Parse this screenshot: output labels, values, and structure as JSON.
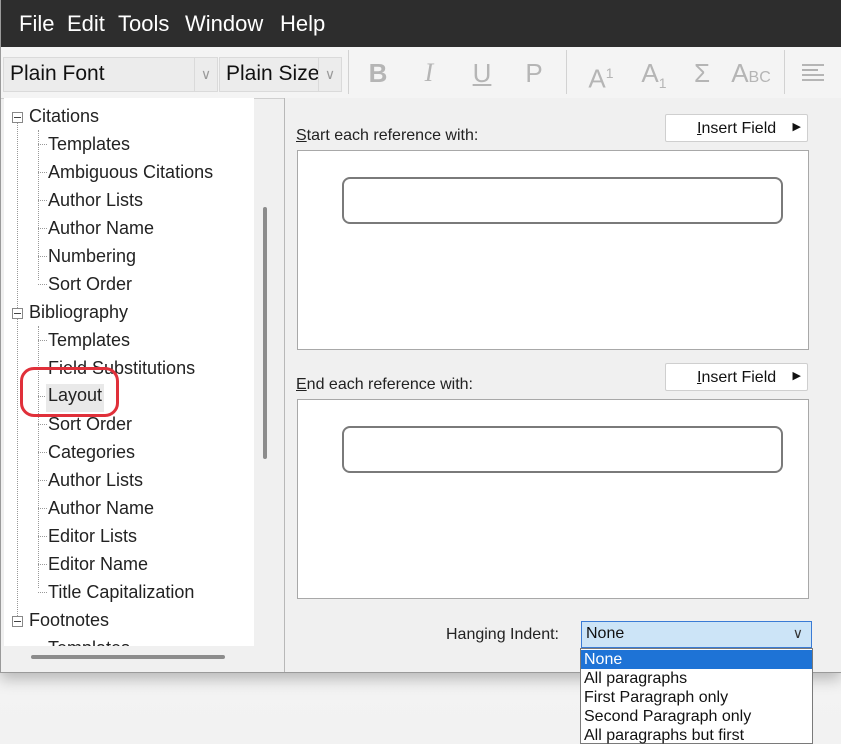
{
  "menu": {
    "file": "File",
    "edit": "Edit",
    "tools": "Tools",
    "window": "Window",
    "help": "Help"
  },
  "toolbar": {
    "font": "Plain Font",
    "size": "Plain Size",
    "bold": "B",
    "italic": "I",
    "underline": "U",
    "plain": "P",
    "superscript": "A",
    "superscript_mark": "1",
    "subscript": "A",
    "subscript_mark": "1",
    "symbol": "Σ",
    "smallcaps_big": "A",
    "smallcaps_small": "BC",
    "align_icon": "align-left-icon"
  },
  "tree": {
    "citations": {
      "label": "Citations",
      "items": [
        "Templates",
        "Ambiguous Citations",
        "Author Lists",
        "Author Name",
        "Numbering",
        "Sort Order"
      ]
    },
    "bibliography": {
      "label": "Bibliography",
      "items": [
        "Templates",
        "Field Substitutions",
        "Layout",
        "Sort Order",
        "Categories",
        "Author Lists",
        "Author Name",
        "Editor Lists",
        "Editor Name",
        "Title Capitalization"
      ]
    },
    "footnotes": {
      "label": "Footnotes",
      "items": [
        "Templates"
      ]
    },
    "selected": "Layout",
    "annotation_color": "#e0303a"
  },
  "layout_panel": {
    "start_label": "Start each reference with:",
    "end_label": "End each reference with:",
    "insert_field": "Insert Field",
    "start_value": "",
    "end_value": "",
    "hanging_indent_label": "Hanging Indent:",
    "hanging_indent_value": "None",
    "options": [
      "None",
      "All paragraphs",
      "First Paragraph only",
      "Second Paragraph only",
      "All paragraphs but first"
    ]
  }
}
